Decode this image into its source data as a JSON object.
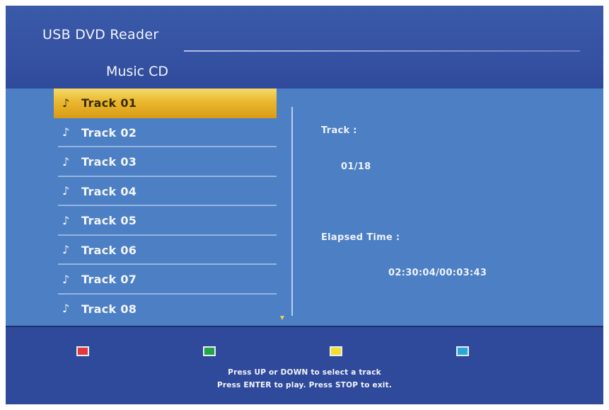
{
  "app_title": "USB DVD Reader",
  "section_title": "Music CD",
  "track_icon": "music-note-icon",
  "tracks": [
    {
      "label": "Track 01",
      "selected": true
    },
    {
      "label": "Track 02",
      "selected": false
    },
    {
      "label": "Track 03",
      "selected": false
    },
    {
      "label": "Track 04",
      "selected": false
    },
    {
      "label": "Track 05",
      "selected": false
    },
    {
      "label": "Track 06",
      "selected": false
    },
    {
      "label": "Track 07",
      "selected": false
    },
    {
      "label": "Track 08",
      "selected": false
    }
  ],
  "info": {
    "track_label": "Track :",
    "track_value": "01/18",
    "elapsed_label": "Elapsed Time :",
    "elapsed_value": "02:30:04/00:03:43"
  },
  "color_keys": [
    {
      "name": "red",
      "color": "#e0383b"
    },
    {
      "name": "green",
      "color": "#23a34a"
    },
    {
      "name": "yellow",
      "color": "#f2df2a"
    },
    {
      "name": "blue",
      "color": "#2ba6dc"
    }
  ],
  "hints": {
    "line1": "Press UP or DOWN to select a track",
    "line2": "Press ENTER to play. Press STOP to exit."
  },
  "colors": {
    "background": "#2f4a9a",
    "content_area": "#4c7fc3",
    "highlight": "#e9b82e"
  }
}
